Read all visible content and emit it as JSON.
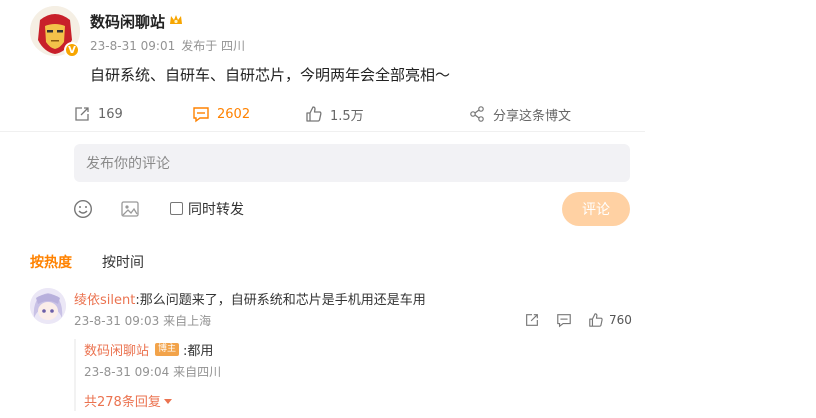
{
  "post": {
    "author": "数码闲聊站",
    "time": "23-8-31 09:01",
    "location": "发布于 四川",
    "text": "自研系统、自研车、自研芯片，今明两年会全部亮相～",
    "verified_badge": "V"
  },
  "actions": {
    "repost_count": "169",
    "comment_count": "2602",
    "like_count": "1.5万",
    "share_label": "分享这条博文"
  },
  "composer": {
    "placeholder": "发布你的评论",
    "forward_label": "同时转发",
    "submit_label": "评论"
  },
  "sort": {
    "hot": "按热度",
    "time": "按时间"
  },
  "comment": {
    "user": "绫依silent",
    "text": ":那么问题来了，自研系统和芯片是手机用还是车用",
    "time": "23-8-31 09:03",
    "location": "来自上海",
    "like_count": "760",
    "reply": {
      "user": "数码闲聊站",
      "badge": "博主",
      "text": ":都用",
      "time": "23-8-31 09:04",
      "location": "来自四川"
    },
    "more_replies": "共278条回复"
  },
  "colors": {
    "accent": "#ff8200",
    "username": "#eb7350",
    "submit_disabled": "#ffd1a3"
  },
  "icons": [
    "repost-icon",
    "comment-icon",
    "like-icon",
    "share-icon",
    "emoji-icon",
    "image-icon",
    "crown-icon",
    "caret-down-icon"
  ]
}
